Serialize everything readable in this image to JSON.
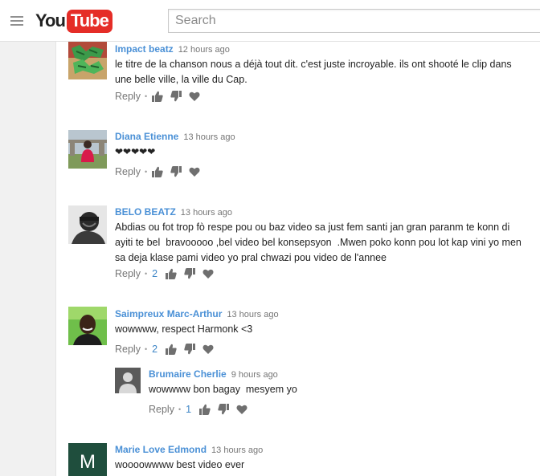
{
  "header": {
    "logo_you": "You",
    "logo_tube": "Tube",
    "search_placeholder": "Search"
  },
  "colors": {
    "author": "#4a90d6",
    "count": "#3d85c6",
    "logo_red": "#e52d27",
    "icon_gray": "#6f6f6f"
  },
  "comments": [
    {
      "author": "Impact beatz",
      "time": "12 hours ago",
      "text": "le titre de la chanson nous a déjà tout dit. c'est juste incroyable. ils ont shooté le clip dans\nune belle ville, la ville du Cap.",
      "reply_label": "Reply",
      "reply_count": ""
    },
    {
      "author": "Diana Etienne",
      "time": "13 hours ago",
      "text": "❤❤❤❤❤",
      "reply_label": "Reply",
      "reply_count": ""
    },
    {
      "author": "BELO BEATZ",
      "time": "13 hours ago",
      "text": "Abdias ou fot trop fò respe pou ou baz video sa just fem santi jan gran paranm te konn di\nayiti te bel  bravooooo ,bel video bel konsepsyon  .Mwen poko konn pou lot kap vini yo men\nsa deja klase pami video yo pral chwazi pou video de l'annee",
      "reply_label": "Reply",
      "reply_count": "2"
    },
    {
      "author": "Saimpreux Marc-Arthur",
      "time": "13 hours ago",
      "text": "wowwww, respect Harmonk <3",
      "reply_label": "Reply",
      "reply_count": "2"
    },
    {
      "author": "Brumaire Cherlie",
      "time": "9 hours ago",
      "text": "wowwww bon bagay  mesyem yo",
      "reply_label": "Reply",
      "reply_count": "1"
    },
    {
      "author": "Marie Love Edmond",
      "time": "13 hours ago",
      "text": "woooowwww best video ever",
      "avatar_letter": "M",
      "reply_label": "Reply",
      "reply_count": ""
    }
  ]
}
